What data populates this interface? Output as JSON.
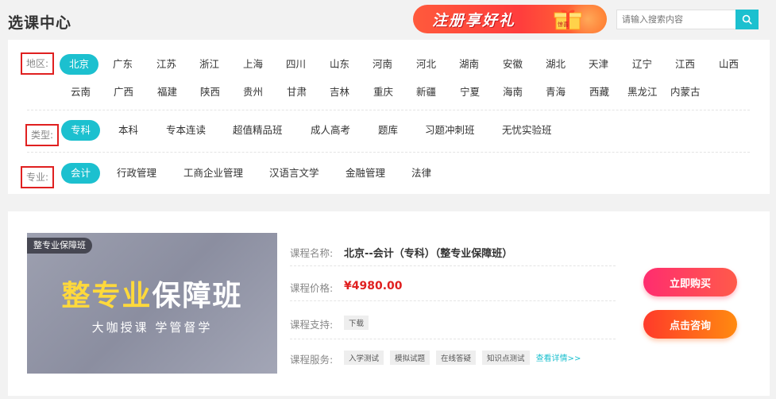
{
  "page": {
    "title": "选课中心"
  },
  "banner": {
    "text": "注册享好礼",
    "gift_text": "惊喜"
  },
  "search": {
    "placeholder": "请输入搜索内容"
  },
  "filters": {
    "region": {
      "label": "地区:",
      "options": [
        "北京",
        "广东",
        "江苏",
        "浙江",
        "上海",
        "四川",
        "山东",
        "河南",
        "河北",
        "湖南",
        "安徽",
        "湖北",
        "天津",
        "辽宁",
        "江西",
        "山西",
        "云南",
        "广西",
        "福建",
        "陕西",
        "贵州",
        "甘肃",
        "吉林",
        "重庆",
        "新疆",
        "宁夏",
        "海南",
        "青海",
        "西藏",
        "黑龙江",
        "内蒙古"
      ],
      "selected": "北京"
    },
    "type": {
      "label": "类型:",
      "options": [
        "专科",
        "本科",
        "专本连读",
        "超值精品班",
        "成人高考",
        "题库",
        "习题冲刺班",
        "无忧实验班"
      ],
      "selected": "专科"
    },
    "major": {
      "label": "专业:",
      "options": [
        "会计",
        "行政管理",
        "工商企业管理",
        "汉语言文学",
        "金融管理",
        "法律"
      ],
      "selected": "会计"
    }
  },
  "course": {
    "image": {
      "tag": "整专业保障班",
      "title_yellow": "整专业",
      "title_white": "保障班",
      "subtitle": "大咖授课 学管督学"
    },
    "name_label": "课程名称:",
    "name": "北京--会计（专科）（整专业保障班）",
    "price_label": "课程价格:",
    "price": "¥4980.00",
    "support_label": "课程支持:",
    "support_tags": [
      "下载"
    ],
    "service_label": "课程服务:",
    "service_tags": [
      "入学测试",
      "模拟试题",
      "在线答疑",
      "知识点测试"
    ],
    "details_link": "查看详情>>",
    "buy_button": "立即购买",
    "consult_button": "点击咨询"
  },
  "colors": {
    "accent": "#1cc0cf",
    "price": "#e02020",
    "highlight_border": "#e02020"
  }
}
